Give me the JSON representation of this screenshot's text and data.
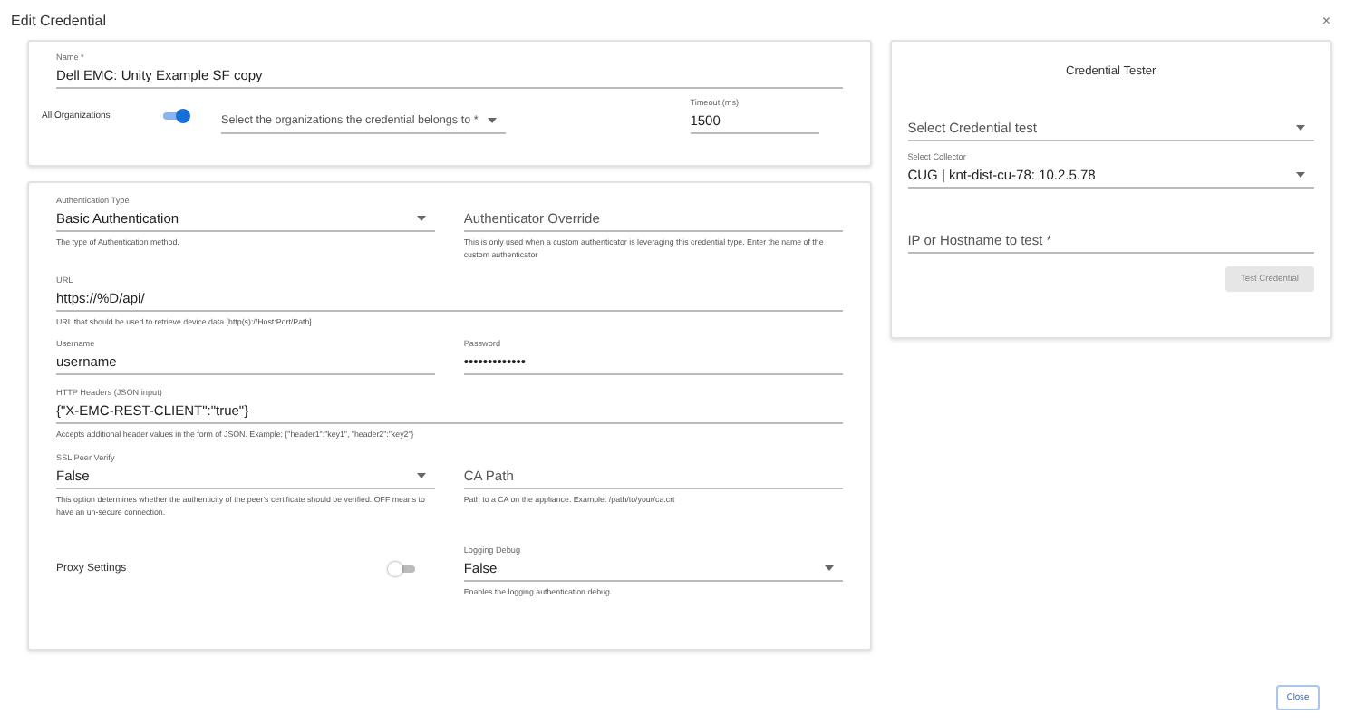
{
  "dialog": {
    "title": "Edit Credential",
    "close_glyph": "×"
  },
  "general": {
    "name": {
      "kind": "input",
      "label": "Name *",
      "value": "Dell EMC: Unity Example SF copy"
    },
    "all_organizations": {
      "label": "All Organizations",
      "on": true
    },
    "organizations": {
      "kind": "select",
      "placeholder": "Select the organizations the credential belongs to *"
    },
    "timeout": {
      "kind": "input",
      "label": "Timeout (ms)",
      "value": "1500"
    }
  },
  "settings": {
    "rows": [
      [
        {
          "kind": "select",
          "label": "Authentication Type",
          "value": "Basic Authentication",
          "help": "The type of Authentication method."
        },
        {
          "kind": "input",
          "placeholder": "Authenticator Override",
          "help": "This is only used when a custom authenticator is leveraging this credential type. Enter the name of the custom authenticator"
        }
      ],
      [
        {
          "kind": "input",
          "label": "URL",
          "value": "https://%D/api/",
          "help": "URL that should be used to retrieve device data [http(s)://Host:Port/Path]"
        }
      ],
      [
        {
          "kind": "input",
          "label": "Username",
          "value": "username"
        },
        {
          "kind": "input",
          "label": "Password",
          "value": "•••••••••••••"
        }
      ],
      [
        {
          "kind": "input",
          "label": "HTTP Headers (JSON input)",
          "value": "{\"X-EMC-REST-CLIENT\":\"true\"}",
          "help": "Accepts additional header values in the form of JSON. Example: {\"header1\":\"key1\", \"header2\":\"key2\"}"
        }
      ],
      [
        {
          "kind": "select",
          "label": "SSL Peer Verify",
          "value": "False",
          "help": "This option determines whether the authenticity of the peer's certificate should be verified. OFF means to have an un-secure connection."
        },
        {
          "kind": "input",
          "placeholder": "CA Path",
          "help": "Path to a CA on the appliance. Example: /path/to/your/ca.crt"
        }
      ],
      [
        {
          "kind": "toggle",
          "label": "Proxy Settings",
          "on": false
        },
        {
          "kind": "select",
          "label": "Logging Debug",
          "value": "False",
          "help": "Enables the logging authentication debug."
        }
      ]
    ]
  },
  "tester": {
    "title": "Credential Tester",
    "fields": [
      {
        "kind": "select",
        "placeholder": "Select Credential test"
      },
      {
        "kind": "select",
        "label": "Select Collector",
        "value": "CUG | knt-dist-cu-78: 10.2.5.78"
      },
      {
        "kind": "input",
        "placeholder": "IP or Hostname to test *"
      }
    ],
    "button": {
      "label": "Test Credential",
      "disabled": true
    }
  },
  "footer": {
    "close_button": "Close"
  }
}
